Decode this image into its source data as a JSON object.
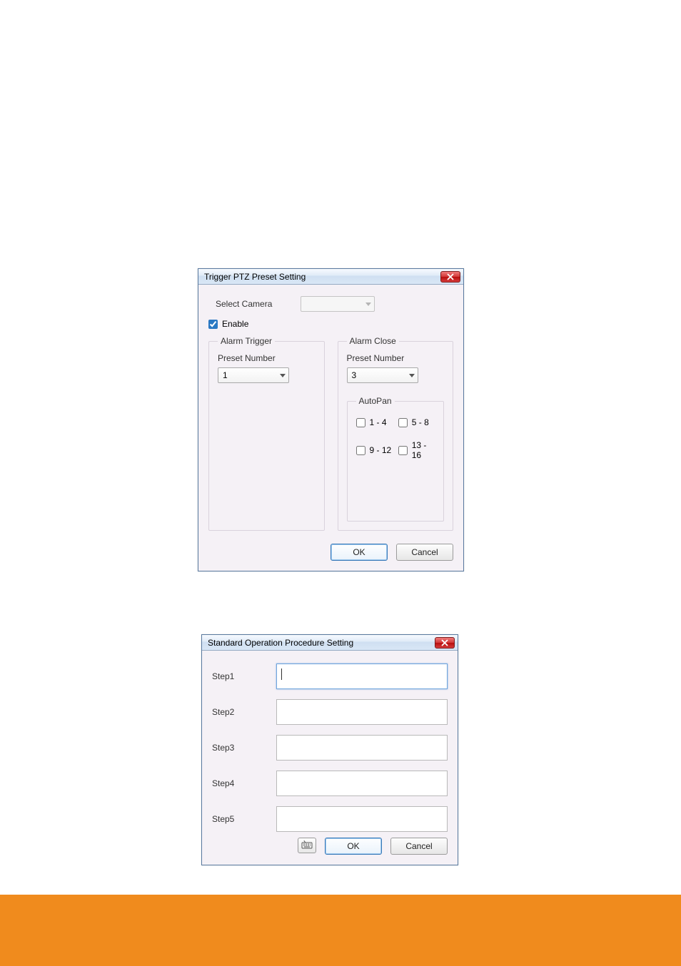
{
  "dialog1": {
    "title": "Trigger PTZ Preset Setting",
    "select_camera_label": "Select Camera",
    "select_camera_value": "",
    "enable_label": "Enable",
    "enable_checked": true,
    "alarm_trigger": {
      "legend": "Alarm Trigger",
      "preset_label": "Preset Number",
      "preset_value": "1"
    },
    "alarm_close": {
      "legend": "Alarm Close",
      "preset_label": "Preset Number",
      "preset_value": "3",
      "autopan": {
        "legend": "AutoPan",
        "options": [
          {
            "label": "1 - 4",
            "checked": false
          },
          {
            "label": "5 - 8",
            "checked": false
          },
          {
            "label": "9 - 12",
            "checked": false
          },
          {
            "label": "13 - 16",
            "checked": false
          }
        ]
      }
    },
    "buttons": {
      "ok": "OK",
      "cancel": "Cancel"
    }
  },
  "dialog2": {
    "title": "Standard Operation Procedure Setting",
    "steps": [
      {
        "label": "Step1",
        "value": ""
      },
      {
        "label": "Step2",
        "value": ""
      },
      {
        "label": "Step3",
        "value": ""
      },
      {
        "label": "Step4",
        "value": ""
      },
      {
        "label": "Step5",
        "value": ""
      }
    ],
    "buttons": {
      "ok": "OK",
      "cancel": "Cancel"
    }
  },
  "colors": {
    "footer": "#f08b1d"
  }
}
